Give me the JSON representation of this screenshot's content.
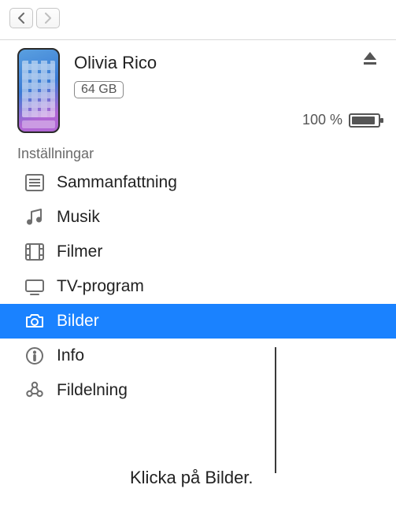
{
  "device": {
    "name": "Olivia Rico",
    "storage": "64 GB",
    "battery_text": "100 %",
    "battery_fill_pct": 90
  },
  "section_label": "Inställningar",
  "items": [
    {
      "key": "summary",
      "label": "Sammanfattning",
      "icon": "list",
      "selected": false
    },
    {
      "key": "music",
      "label": "Musik",
      "icon": "music",
      "selected": false
    },
    {
      "key": "movies",
      "label": "Filmer",
      "icon": "film",
      "selected": false
    },
    {
      "key": "tv",
      "label": "TV-program",
      "icon": "tv",
      "selected": false
    },
    {
      "key": "photos",
      "label": "Bilder",
      "icon": "camera",
      "selected": true
    },
    {
      "key": "info",
      "label": "Info",
      "icon": "info",
      "selected": false
    },
    {
      "key": "files",
      "label": "Fildelning",
      "icon": "apps",
      "selected": false
    }
  ],
  "callout": "Klicka på Bilder."
}
